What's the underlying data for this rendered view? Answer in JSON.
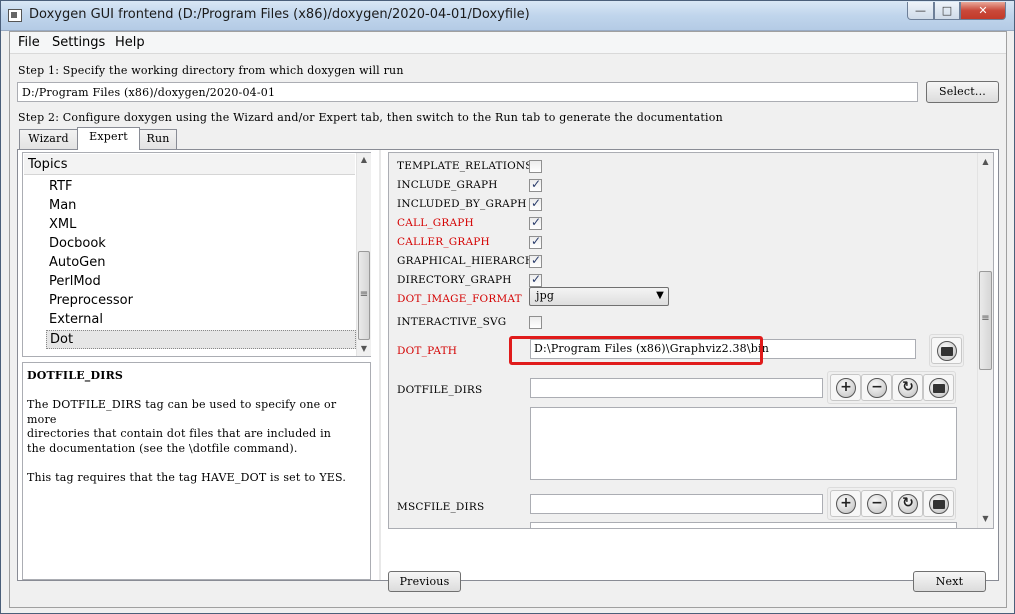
{
  "window": {
    "title": "Doxygen GUI frontend (D:/Program Files (x86)/doxygen/2020-04-01/Doxyfile)",
    "controls": {
      "minimize": "—",
      "maximize": "□",
      "close": "✕"
    }
  },
  "menu": [
    "File",
    "Settings",
    "Help"
  ],
  "step1": {
    "label": "Step 1: Specify the working directory from which doxygen will run",
    "value": "D:/Program Files (x86)/doxygen/2020-04-01",
    "select_label": "Select..."
  },
  "step2": {
    "label": "Step 2: Configure doxygen using the Wizard and/or Expert tab, then switch to the Run tab to generate the documentation"
  },
  "tabs": [
    "Wizard",
    "Expert",
    "Run"
  ],
  "topics": {
    "header": "Topics",
    "items": [
      "RTF",
      "Man",
      "XML",
      "Docbook",
      "AutoGen",
      "PerlMod",
      "Preprocessor",
      "External",
      "Dot"
    ],
    "selected": "Dot"
  },
  "help": {
    "title": "DOTFILE_DIRS",
    "line1": "The DOTFILE_DIRS tag can be used to specify one or more",
    "line2": "directories that contain dot files that are included in",
    "line3": "the documentation (see the \\dotfile command).",
    "line4": "This tag requires that the tag HAVE_DOT is set to YES."
  },
  "options": {
    "template_relations": {
      "label": "TEMPLATE_RELATIONS",
      "checked": false
    },
    "include_graph": {
      "label": "INCLUDE_GRAPH",
      "checked": true
    },
    "included_by_graph": {
      "label": "INCLUDED_BY_GRAPH",
      "checked": true
    },
    "call_graph": {
      "label": "CALL_GRAPH",
      "checked": true
    },
    "caller_graph": {
      "label": "CALLER_GRAPH",
      "checked": true
    },
    "graphical_hierarchy": {
      "label": "GRAPHICAL_HIERARCHY",
      "checked": true
    },
    "directory_graph": {
      "label": "DIRECTORY_GRAPH",
      "checked": true
    },
    "dot_image_format": {
      "label": "DOT_IMAGE_FORMAT",
      "value": "jpg"
    },
    "interactive_svg": {
      "label": "INTERACTIVE_SVG",
      "checked": false
    },
    "dot_path": {
      "label": "DOT_PATH",
      "value": "D:\\Program Files (x86)\\Graphviz2.38\\bin"
    },
    "dotfile_dirs": {
      "label": "DOTFILE_DIRS"
    },
    "mscfile_dirs": {
      "label": "MSCFILE_DIRS"
    }
  },
  "tool_icons": {
    "add": "+",
    "remove": "−",
    "refresh": "↻"
  },
  "scroll_arrows": {
    "up": "▲",
    "down": "▼",
    "combo": "▼"
  },
  "nav": {
    "previous": "Previous",
    "next": "Next"
  },
  "colors": {
    "required_option": "#d40000",
    "highlight_box": "#e01b1b"
  }
}
